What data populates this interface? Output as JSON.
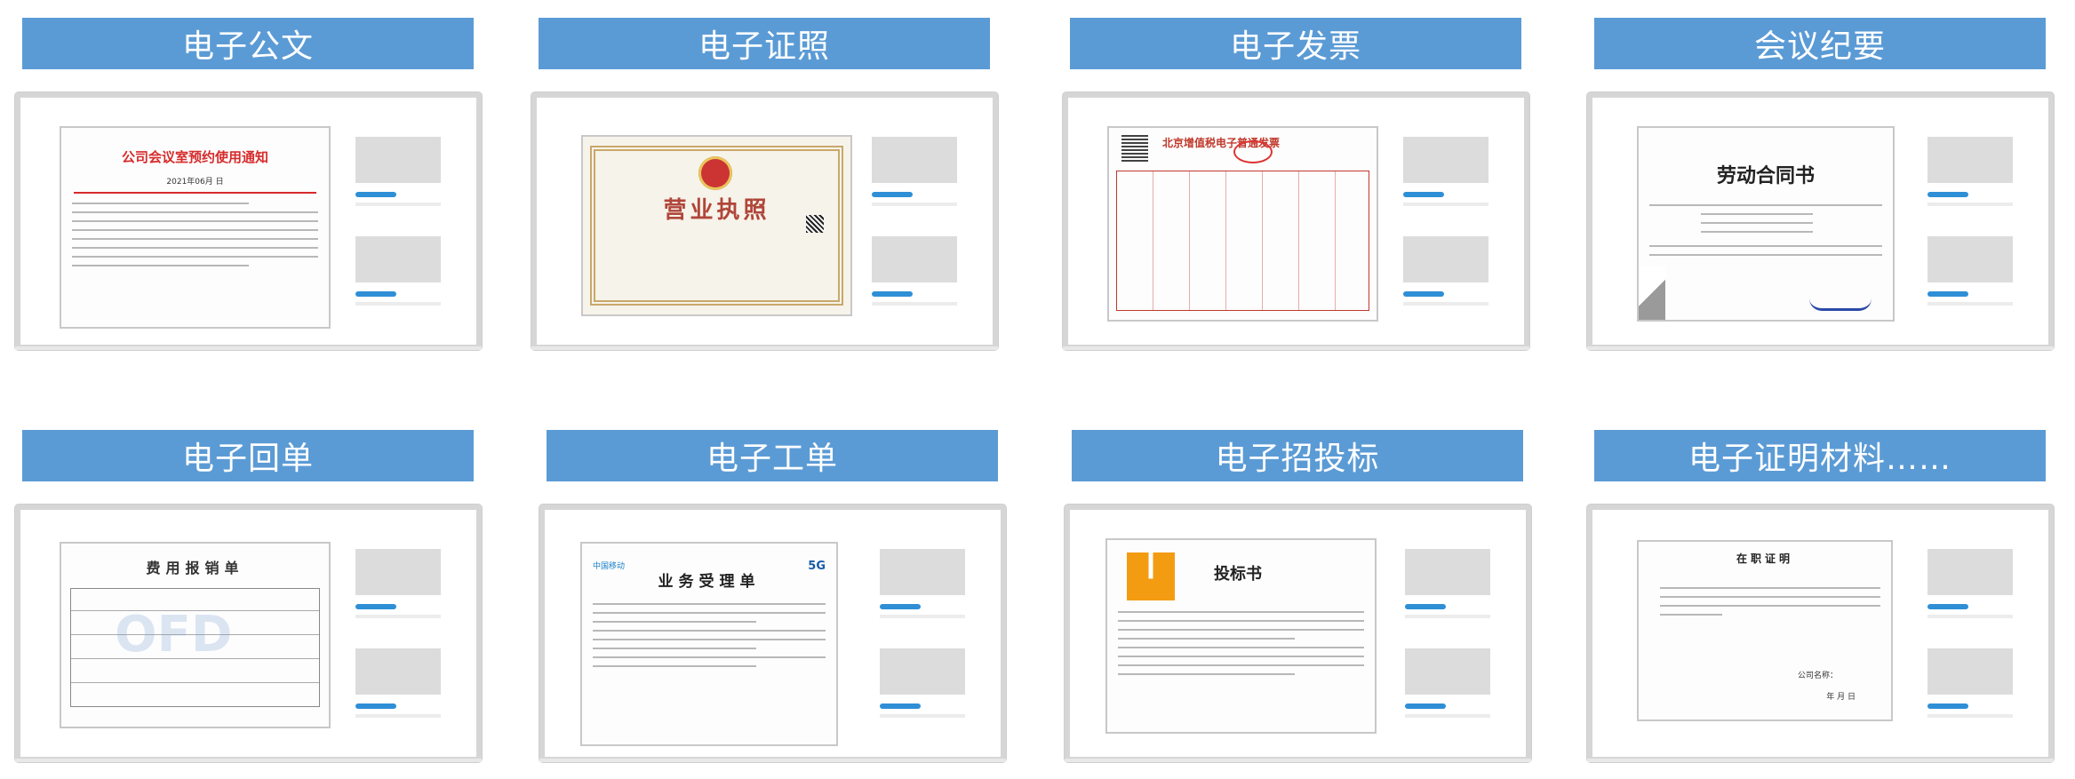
{
  "cards": [
    {
      "title": "电子公文",
      "doc_heading": "公司会议室预约使用通知",
      "doc_date": "2021年06月 日"
    },
    {
      "title": "电子证照",
      "doc_heading": "营业执照"
    },
    {
      "title": "电子发票",
      "doc_heading": "北京增值税电子普通发票"
    },
    {
      "title": "会议纪要",
      "doc_heading": "劳动合同书"
    },
    {
      "title": "电子回单",
      "doc_heading": "费用报销单",
      "watermark": "OFD"
    },
    {
      "title": "电子工单",
      "doc_heading": "业务受理单",
      "logo_text": "中国移动",
      "badge": "5G"
    },
    {
      "title": "电子招投标",
      "doc_heading": "投标书"
    },
    {
      "title": "电子证明材料……",
      "doc_heading": "在职证明",
      "signature_label": "公司名称：",
      "date_label": "年  月  日"
    }
  ],
  "colors": {
    "title_bar": "#5b9bd5",
    "accent_bar": "#2e8fd6",
    "placeholder": "#dcdcdc"
  }
}
